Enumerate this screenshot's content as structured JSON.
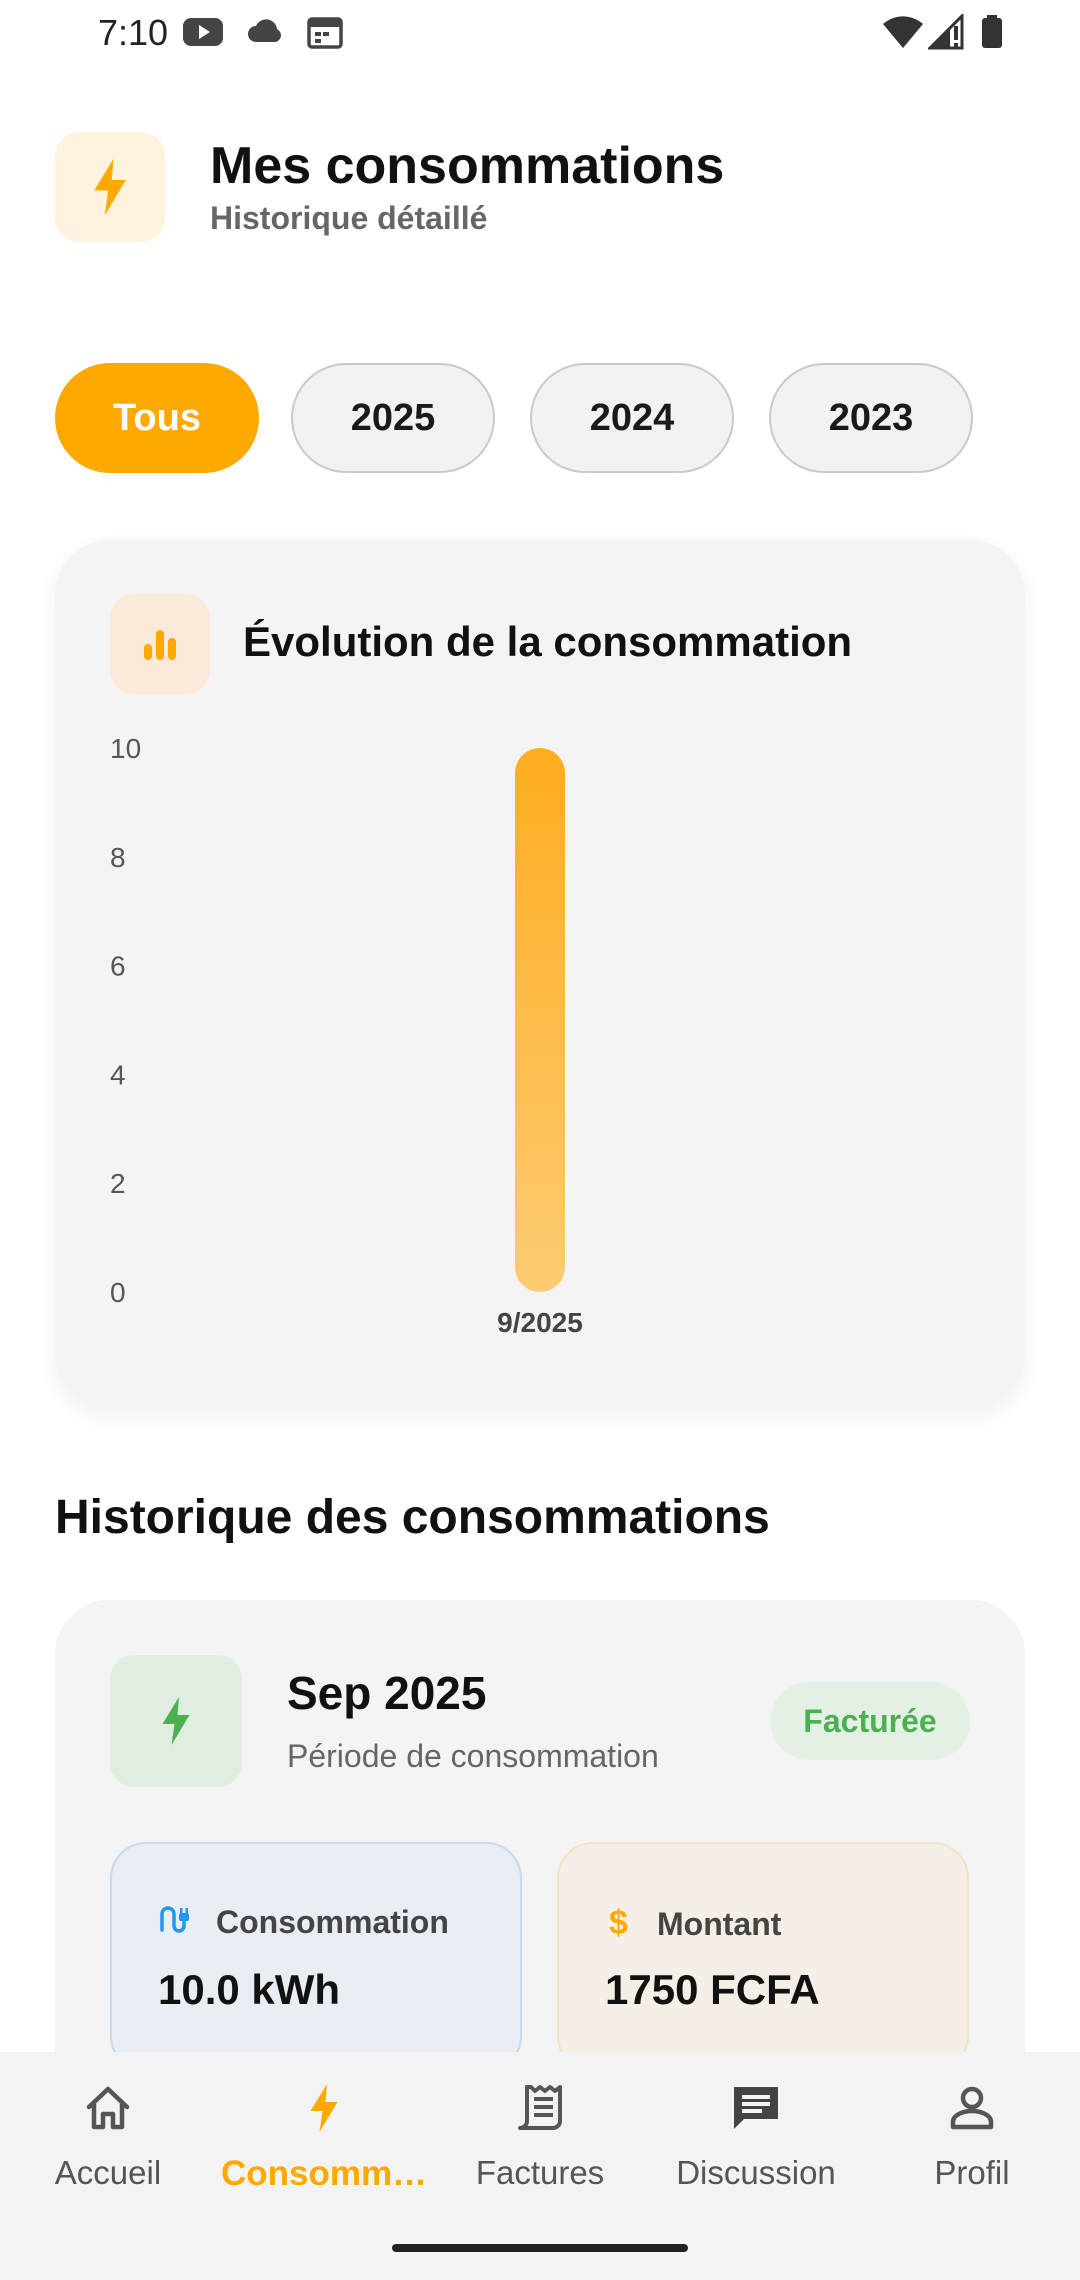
{
  "status_bar": {
    "time": "7:10",
    "icons_left": [
      "youtube-icon",
      "cloud-icon",
      "calendar-icon"
    ],
    "icons_right": [
      "wifi-icon",
      "signal-icon",
      "battery-icon"
    ]
  },
  "header": {
    "title": "Mes consommations",
    "subtitle": "Historique détaillé",
    "icon": "lightning-icon"
  },
  "filters": [
    {
      "label": "Tous",
      "active": true
    },
    {
      "label": "2025",
      "active": false
    },
    {
      "label": "2024",
      "active": false
    },
    {
      "label": "2023",
      "active": false
    }
  ],
  "chart": {
    "title": "Évolution de la consommation",
    "icon": "bar-chart-icon"
  },
  "chart_data": {
    "type": "bar",
    "categories": [
      "9/2025"
    ],
    "values": [
      10.0
    ],
    "title": "Évolution de la consommation",
    "xlabel": "",
    "ylabel": "",
    "ylim": [
      0,
      10
    ],
    "yticks": [
      "0",
      "2",
      "4",
      "6",
      "8",
      "10"
    ],
    "grid": false,
    "bar_color": "#ffa800"
  },
  "history": {
    "section_title": "Historique des consommations",
    "items": [
      {
        "period": "Sep 2025",
        "subtitle": "Période de consommation",
        "status": "Facturée",
        "consumption_label": "Consommation",
        "consumption_value": "10.0 kWh",
        "amount_label": "Montant",
        "amount_value": "1750 FCFA"
      }
    ]
  },
  "nav": {
    "items": [
      {
        "label": "Accueil",
        "icon": "home-icon",
        "active": false
      },
      {
        "label": "Consomm…",
        "icon": "lightning-icon",
        "active": true
      },
      {
        "label": "Factures",
        "icon": "receipt-icon",
        "active": false
      },
      {
        "label": "Discussion",
        "icon": "chat-icon",
        "active": false
      },
      {
        "label": "Profil",
        "icon": "person-icon",
        "active": false
      }
    ]
  },
  "colors": {
    "accent": "#ffa800",
    "success": "#4caf50",
    "info": "#2196f3"
  }
}
